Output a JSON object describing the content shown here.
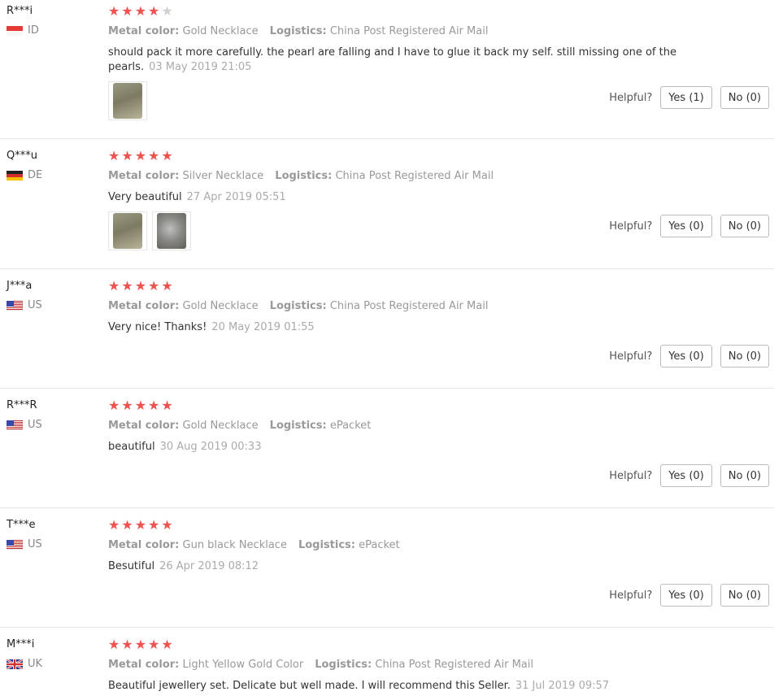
{
  "colors": {
    "star_on": "#ef5350",
    "star_off": "#d0d0d0"
  },
  "labels": {
    "metal_color": "Metal color:",
    "logistics": "Logistics:",
    "helpful": "Helpful?"
  },
  "reviews": [
    {
      "user": "R***i",
      "country": "ID",
      "flag": "indonesia-flag-icon",
      "rating": 4,
      "metal_color": "Gold Necklace",
      "logistics": "China Post Registered Air Mail",
      "comment": "should pack it more carefully. the pearl are falling and I have to glue it back my self. still missing one of the pearls.",
      "date": "03 May 2019 21:05",
      "images": [
        "review-photo-1"
      ],
      "yes": "Yes (1)",
      "no": "No (0)"
    },
    {
      "user": "Q***u",
      "country": "DE",
      "flag": "germany-flag-icon",
      "rating": 5,
      "metal_color": "Silver Necklace",
      "logistics": "China Post Registered Air Mail",
      "comment": "Very beautiful",
      "date": "27 Apr 2019 05:51",
      "images": [
        "review-photo-1",
        "review-photo-2"
      ],
      "yes": "Yes (0)",
      "no": "No (0)"
    },
    {
      "user": "J***a",
      "country": "US",
      "flag": "usa-flag-icon",
      "rating": 5,
      "metal_color": "Gold Necklace",
      "logistics": "China Post Registered Air Mail",
      "comment": "Very nice! Thanks!",
      "date": "20 May 2019 01:55",
      "images": [],
      "yes": "Yes (0)",
      "no": "No (0)"
    },
    {
      "user": "R***R",
      "country": "US",
      "flag": "usa-flag-icon",
      "rating": 5,
      "metal_color": "Gold Necklace",
      "logistics": "ePacket",
      "comment": "beautiful",
      "date": "30 Aug 2019 00:33",
      "images": [],
      "yes": "Yes (0)",
      "no": "No (0)"
    },
    {
      "user": "T***e",
      "country": "US",
      "flag": "usa-flag-icon",
      "rating": 5,
      "metal_color": "Gun black Necklace",
      "logistics": "ePacket",
      "comment": "Besutiful",
      "date": "26 Apr 2019 08:12",
      "images": [],
      "yes": "Yes (0)",
      "no": "No (0)"
    },
    {
      "user": "M***i",
      "country": "UK",
      "flag": "uk-flag-icon",
      "rating": 5,
      "metal_color": "Light Yellow Gold Color",
      "logistics": "China Post Registered Air Mail",
      "comment": "Beautiful jewellery set. Delicate but well made. I will recommend this Seller.",
      "date": "31 Jul 2019 09:57",
      "images": []
    }
  ]
}
